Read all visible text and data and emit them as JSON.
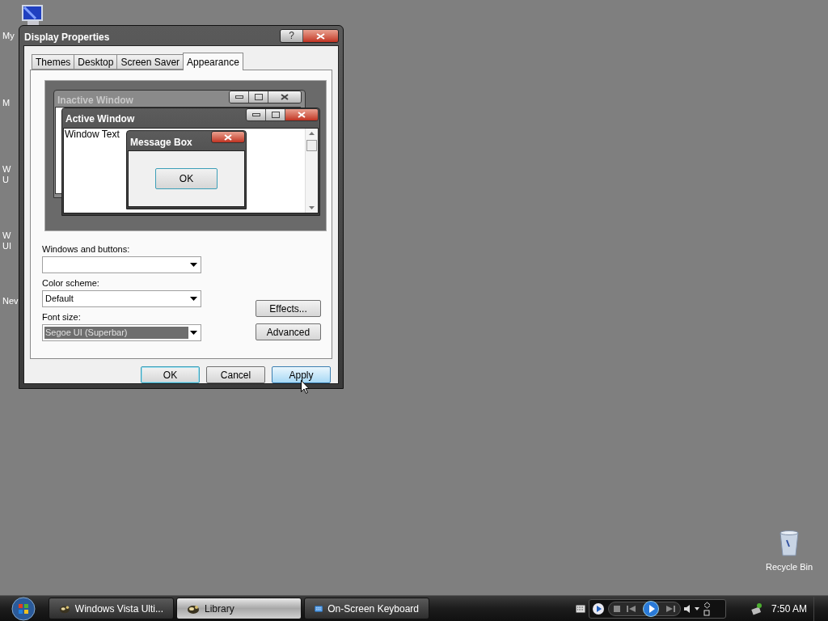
{
  "desktop_icons": [
    {
      "lines": [
        "My"
      ]
    },
    {
      "lines": [
        "M"
      ]
    },
    {
      "lines": [
        "W",
        "U"
      ]
    },
    {
      "lines": [
        "W",
        "UI"
      ]
    },
    {
      "lines": [
        "Nev"
      ]
    }
  ],
  "recycle_bin": {
    "label": "Recycle Bin"
  },
  "dialog": {
    "title": "Display Properties",
    "help": "?",
    "tabs": [
      {
        "label": "Themes",
        "selected": false
      },
      {
        "label": "Desktop",
        "selected": false
      },
      {
        "label": "Screen Saver",
        "selected": false
      },
      {
        "label": "Appearance",
        "selected": true
      }
    ],
    "preview": {
      "inactive_title": "Inactive Window",
      "active_title": "Active Window",
      "window_text": "Window Text",
      "message_title": "Message Box",
      "message_button": "OK"
    },
    "fields": [
      {
        "label": "Windows and buttons:"
      },
      {
        "label": "Color scheme:",
        "value": "Default"
      },
      {
        "label": "Font size:",
        "value": "Segoe UI (Superbar)",
        "highlighted": true
      }
    ],
    "side_buttons": [
      "Effects...",
      "Advanced"
    ],
    "buttons": [
      {
        "label": "OK",
        "kind": "default"
      },
      {
        "label": "Cancel",
        "kind": "normal"
      },
      {
        "label": "Apply",
        "kind": "hover"
      }
    ]
  },
  "taskbar": {
    "tasks": [
      {
        "label": "Windows Vista Ulti...",
        "selected": false
      },
      {
        "label": "Library",
        "selected": true
      },
      {
        "label": "On-Screen Keyboard",
        "selected": false
      }
    ],
    "clock": "7:50 AM"
  }
}
